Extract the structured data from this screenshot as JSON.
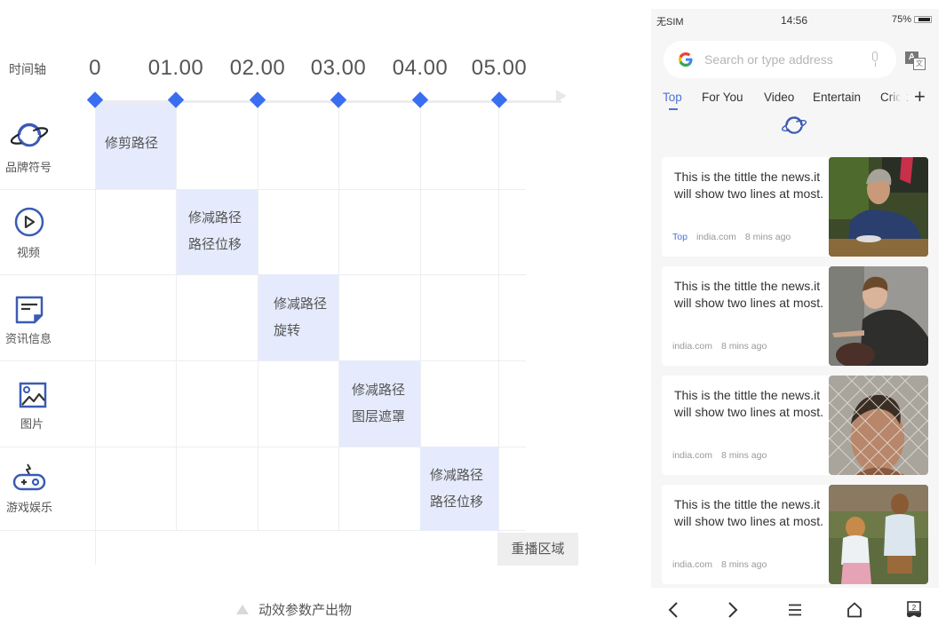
{
  "diagram": {
    "axis_label": "时间轴",
    "ticks": [
      "0",
      "01.00",
      "02.00",
      "03.00",
      "04.00",
      "05.00"
    ],
    "rows": [
      {
        "label": "品牌符号",
        "icon": "planet-icon"
      },
      {
        "label": "视频",
        "icon": "play-circle-icon"
      },
      {
        "label": "资讯信息",
        "icon": "note-icon"
      },
      {
        "label": "图片",
        "icon": "image-icon"
      },
      {
        "label": "游戏娱乐",
        "icon": "gamepad-icon"
      }
    ],
    "cells": [
      {
        "row": 0,
        "col": 0,
        "lines": [
          "修剪路径"
        ]
      },
      {
        "row": 1,
        "col": 1,
        "lines": [
          "修减路径",
          "路径位移"
        ]
      },
      {
        "row": 2,
        "col": 2,
        "lines": [
          "修减路径",
          "旋转"
        ]
      },
      {
        "row": 3,
        "col": 3,
        "lines": [
          "修减路径",
          "图层遮罩"
        ]
      },
      {
        "row": 4,
        "col": 4,
        "lines": [
          "修减路径",
          "路径位移"
        ]
      }
    ],
    "replay_button": "重播区域",
    "caption": "动效参数产出物",
    "accent_color": "#3a6ef0",
    "cell_color": "#e5ebfc"
  },
  "phone": {
    "status": {
      "carrier": "无SIM",
      "time": "14:56",
      "battery": "75%"
    },
    "search": {
      "placeholder": "Search or type address"
    },
    "tabs": [
      {
        "label": "Top",
        "active": true
      },
      {
        "label": "For You"
      },
      {
        "label": "Video"
      },
      {
        "label": "Entertain"
      },
      {
        "label": "Crick"
      }
    ],
    "add_tab": "+",
    "news": [
      {
        "title": "This is the tittle the news.it will show two lines at most.",
        "tag": "Top",
        "source": "india.com",
        "time": "8 mins ago",
        "image": "man-eating-photo"
      },
      {
        "title": "This is the tittle the news.it will show two lines at most.",
        "source": "india.com",
        "time": "8 mins ago",
        "image": "boy-laughing-photo"
      },
      {
        "title": "This is the tittle the news.it will show two lines at most.",
        "source": "india.com",
        "time": "8 mins ago",
        "image": "man-behind-fence-photo"
      },
      {
        "title": "This is the tittle the news.it will show two lines at most.",
        "source": "india.com",
        "time": "8 mins ago",
        "image": "two-children-photo"
      }
    ],
    "bottom_nav": [
      "back-icon",
      "forward-icon",
      "menu-icon",
      "home-icon",
      "tabs-icon"
    ],
    "tabs_count": "2",
    "accent_color": "#4a72d6"
  }
}
